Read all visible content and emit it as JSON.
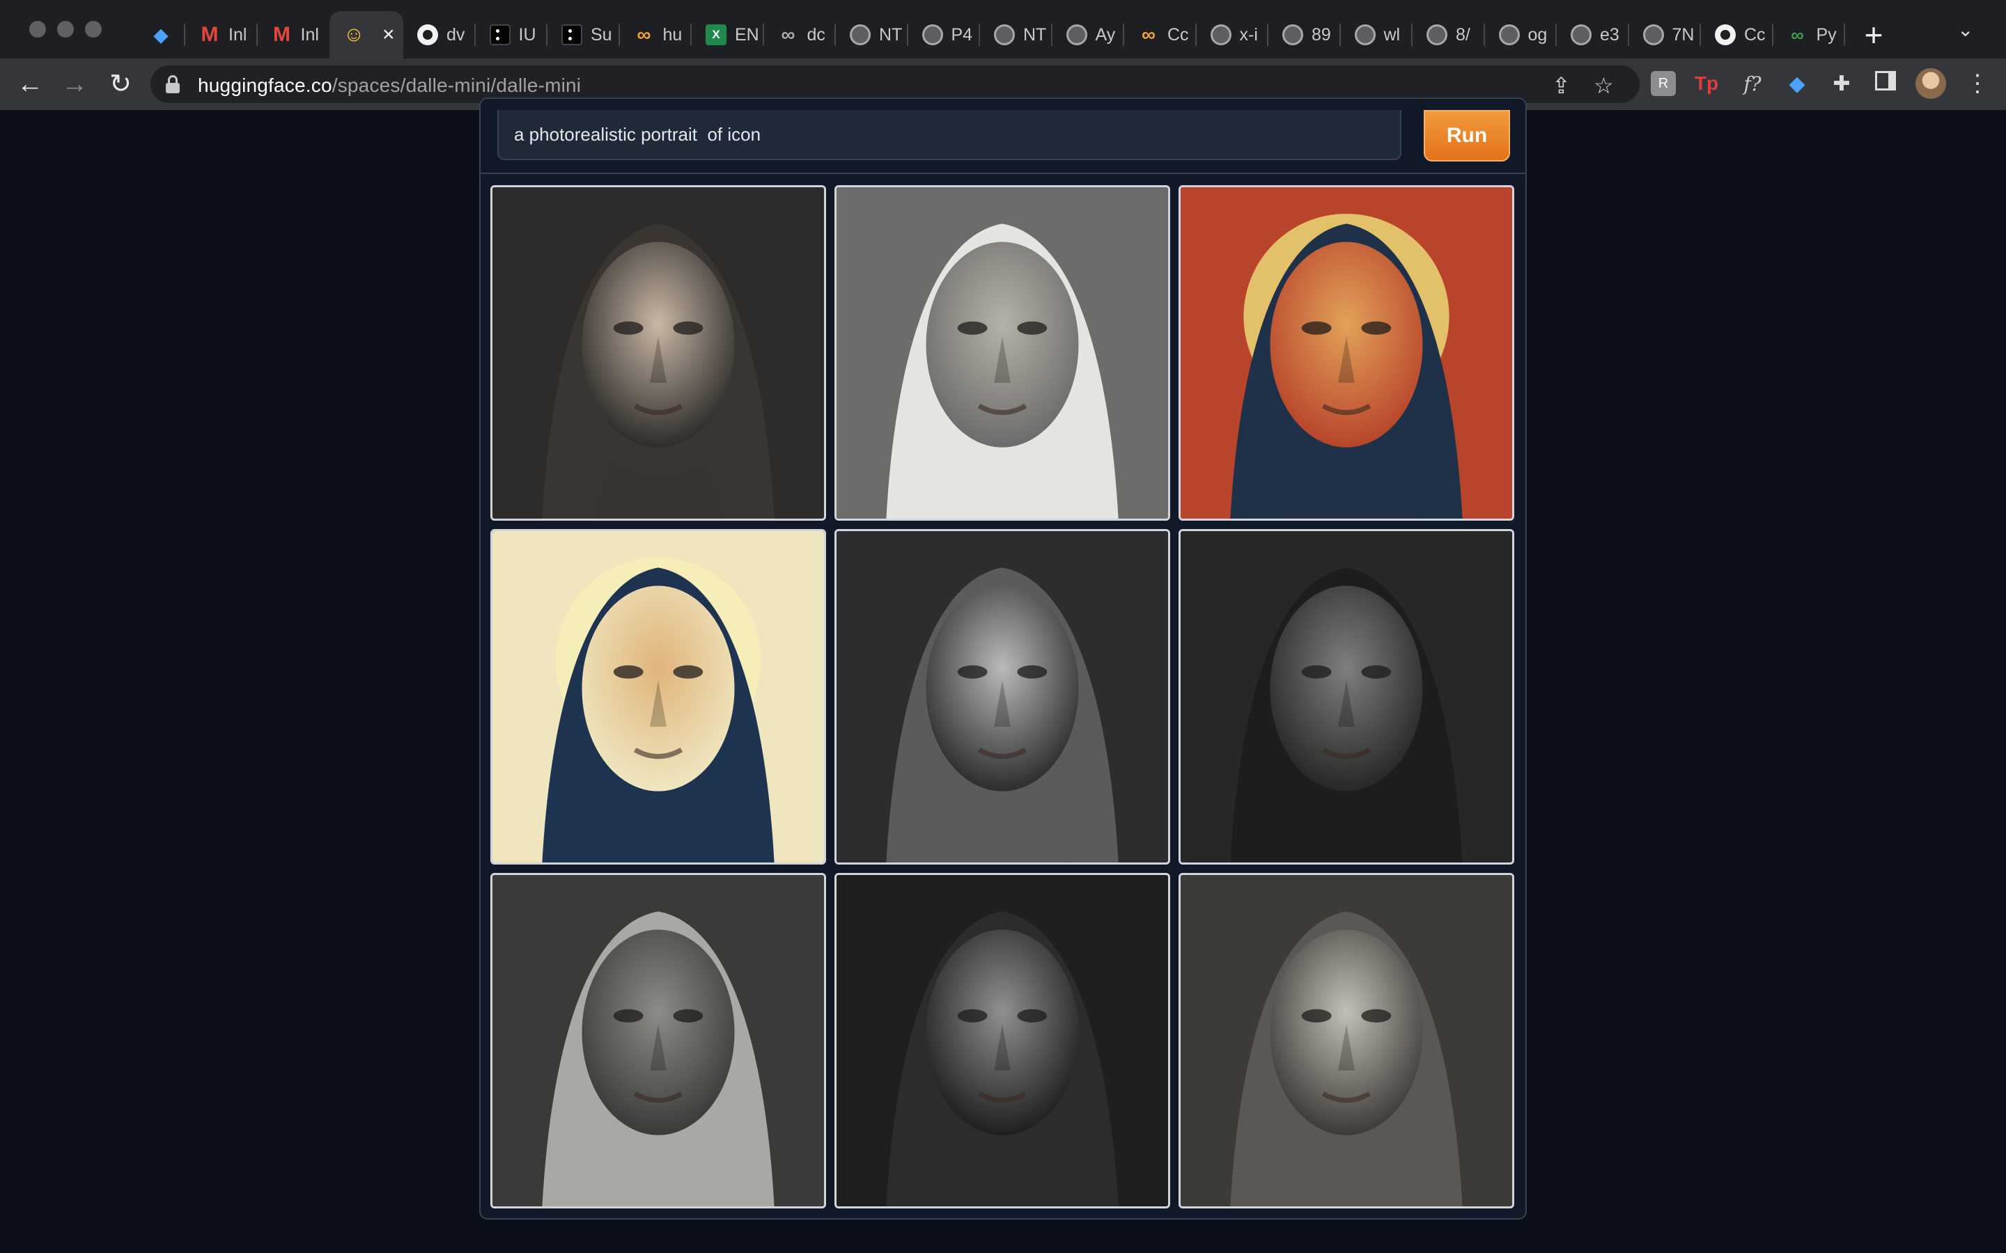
{
  "browser": {
    "tabs": [
      {
        "label": "",
        "icon": "gem-icon"
      },
      {
        "label": "Inl",
        "icon": "gmail-icon"
      },
      {
        "label": "Inl",
        "icon": "gmail-icon"
      },
      {
        "label": "",
        "icon": "hugging-face-icon",
        "active": true
      },
      {
        "label": "dv",
        "icon": "github-icon"
      },
      {
        "label": "IU",
        "icon": "app-icon"
      },
      {
        "label": "Su",
        "icon": "app-icon"
      },
      {
        "label": "hu",
        "icon": "meta-icon"
      },
      {
        "label": "EN",
        "icon": "excel-icon"
      },
      {
        "label": "dc",
        "icon": "meta-icon"
      },
      {
        "label": "NT",
        "icon": "globe-icon"
      },
      {
        "label": "P4",
        "icon": "globe-icon"
      },
      {
        "label": "NT",
        "icon": "globe-icon"
      },
      {
        "label": "Ay",
        "icon": "globe-icon"
      },
      {
        "label": "Cc",
        "icon": "meta-icon"
      },
      {
        "label": "x-i",
        "icon": "globe-icon"
      },
      {
        "label": "89",
        "icon": "globe-icon"
      },
      {
        "label": "wl",
        "icon": "globe-icon"
      },
      {
        "label": "8/",
        "icon": "globe-icon"
      },
      {
        "label": "og",
        "icon": "globe-icon"
      },
      {
        "label": "e3",
        "icon": "globe-icon"
      },
      {
        "label": "7N",
        "icon": "globe-icon"
      },
      {
        "label": "Cc",
        "icon": "github-icon"
      },
      {
        "label": "Py",
        "icon": "python-icon"
      }
    ],
    "url_host": "huggingface.co",
    "url_path": "/spaces/dalle-mini/dalle-mini"
  },
  "app": {
    "prompt_value": "a photorealistic portrait  of icon",
    "run_label": "Run",
    "accent_color": "#e2731b"
  },
  "gallery": {
    "images": [
      {
        "subject": "woman portrait, sepia oval",
        "bg": "#2e2c2a",
        "face": "#c9b8a5",
        "veil": "#3a3530",
        "halo": null
      },
      {
        "subject": "woman with white headscarf",
        "bg": "#6c6c6a",
        "face": "#b7b2a8",
        "veil": "#e4e4e0",
        "halo": null
      },
      {
        "subject": "byzantine icon madonna",
        "bg": "#b8452b",
        "face": "#e2a259",
        "veil": "#1f3149",
        "halo": "#e3c06a"
      },
      {
        "subject": "madonna and child icon",
        "bg": "#efe6c0",
        "face": "#e0b47a",
        "veil": "#1e3350",
        "halo": "#f6eeb8"
      },
      {
        "subject": "elderly man, black and white",
        "bg": "#2c2d2e",
        "face": "#b9bab9",
        "veil": "#5a5b5c",
        "halo": null
      },
      {
        "subject": "old man, dark grey",
        "bg": "#262826",
        "face": "#7d807c",
        "veil": "#1c1e1c",
        "halo": null
      },
      {
        "subject": "woman with grey hood",
        "bg": "#3a3b38",
        "face": "#8d8c86",
        "veil": "#a9a8a2",
        "halo": null
      },
      {
        "subject": "smooth grey face",
        "bg": "#1e201f",
        "face": "#8e918f",
        "veil": "#2b2d2c",
        "halo": null
      },
      {
        "subject": "wrinkled elderly woman",
        "bg": "#3d3b38",
        "face": "#c4bfb6",
        "veil": "#5b5853",
        "halo": null
      }
    ]
  }
}
